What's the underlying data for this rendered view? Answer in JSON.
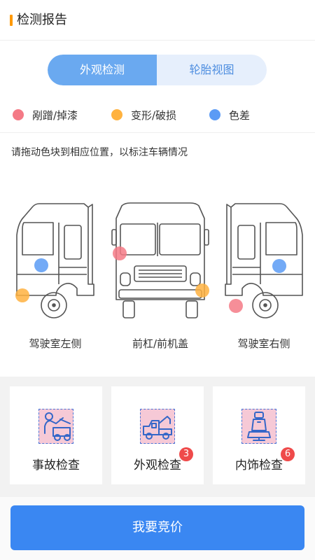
{
  "header": {
    "title": "检测报告",
    "accent": "#ff9900"
  },
  "tabs": [
    {
      "label": "外观检测",
      "active": true
    },
    {
      "label": "轮胎视图",
      "active": false
    }
  ],
  "legend": [
    {
      "label": "剐蹭/掉漆",
      "color": "#f47a86"
    },
    {
      "label": "变形/破损",
      "color": "#ffb23f"
    },
    {
      "label": "色差",
      "color": "#5b9bf5"
    }
  ],
  "hint": "请拖动色块到相应位置，以标注车辆情况",
  "views": [
    {
      "label": "驾驶室左侧"
    },
    {
      "label": "前杠/前机盖"
    },
    {
      "label": "驾驶室右侧"
    }
  ],
  "cards": [
    {
      "label": "事故检查",
      "icon": "mechanic-repair-icon",
      "badge": ""
    },
    {
      "label": "外观检查",
      "icon": "tow-truck-icon",
      "badge": "3"
    },
    {
      "label": "内饰检查",
      "icon": "car-seat-icon",
      "badge": "6"
    }
  ],
  "bid_button": "我要竞价"
}
